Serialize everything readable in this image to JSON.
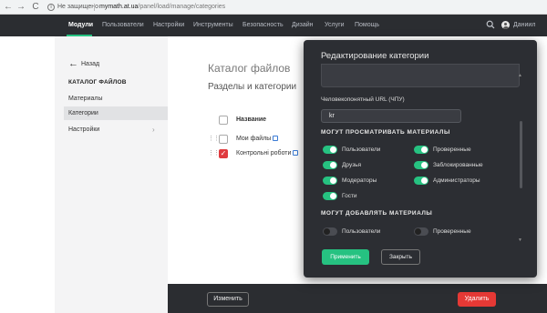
{
  "browser": {
    "back": "←",
    "forward": "→",
    "reload": "C",
    "security_icon": "i",
    "security_text": "Не защищено",
    "url_domain": "mymath.at.ua",
    "url_path": "/panel/load/manage/categories"
  },
  "topnav": {
    "items": [
      "Модули",
      "Пользователи",
      "Настройки",
      "Инструменты",
      "Безопасность",
      "Дизайн",
      "Услуги",
      "Помощь"
    ],
    "active_index": 0,
    "user_name": "Даниил",
    "accent": "#26c281"
  },
  "sidebar": {
    "back_label": "Назад",
    "heading": "КАТАЛОГ ФАЙЛОВ",
    "items": [
      "Материалы",
      "Категории",
      "Настройки"
    ],
    "active_index": 1,
    "chevron": "›"
  },
  "main": {
    "title": "Каталог файлов",
    "section": "Разделы и категории",
    "column_name": "Название",
    "drag_glyph": "⋮⋮",
    "rows": [
      {
        "name": "Мои файлы",
        "checked": false
      },
      {
        "name": "Контрольні роботи",
        "checked": true
      }
    ]
  },
  "bottom": {
    "edit_label": "Изменить",
    "delete_label": "Удалить",
    "delete_color": "#e53935"
  },
  "modal": {
    "title": "Редактирование категории",
    "url_label": "Человекопонятный URL (ЧПУ)",
    "url_value": "kr",
    "view_heading": "МОГУТ ПРОСМАТРИВАТЬ МАТЕРИАЛЫ",
    "view_toggles": [
      {
        "label": "Пользователи",
        "on": true
      },
      {
        "label": "Проверенные",
        "on": true
      },
      {
        "label": "Друзья",
        "on": true
      },
      {
        "label": "Заблокированные",
        "on": true
      },
      {
        "label": "Модераторы",
        "on": true
      },
      {
        "label": "Администраторы",
        "on": true
      },
      {
        "label": "Гости",
        "on": true
      }
    ],
    "add_heading": "МОГУТ ДОБАВЛЯТЬ МАТЕРИАЛЫ",
    "add_toggles": [
      {
        "label": "Пользователи",
        "on": false
      },
      {
        "label": "Проверенные",
        "on": false
      }
    ],
    "apply_label": "Применить",
    "close_label": "Закрыть",
    "scroll_up": "▲",
    "scroll_down": "▼"
  }
}
